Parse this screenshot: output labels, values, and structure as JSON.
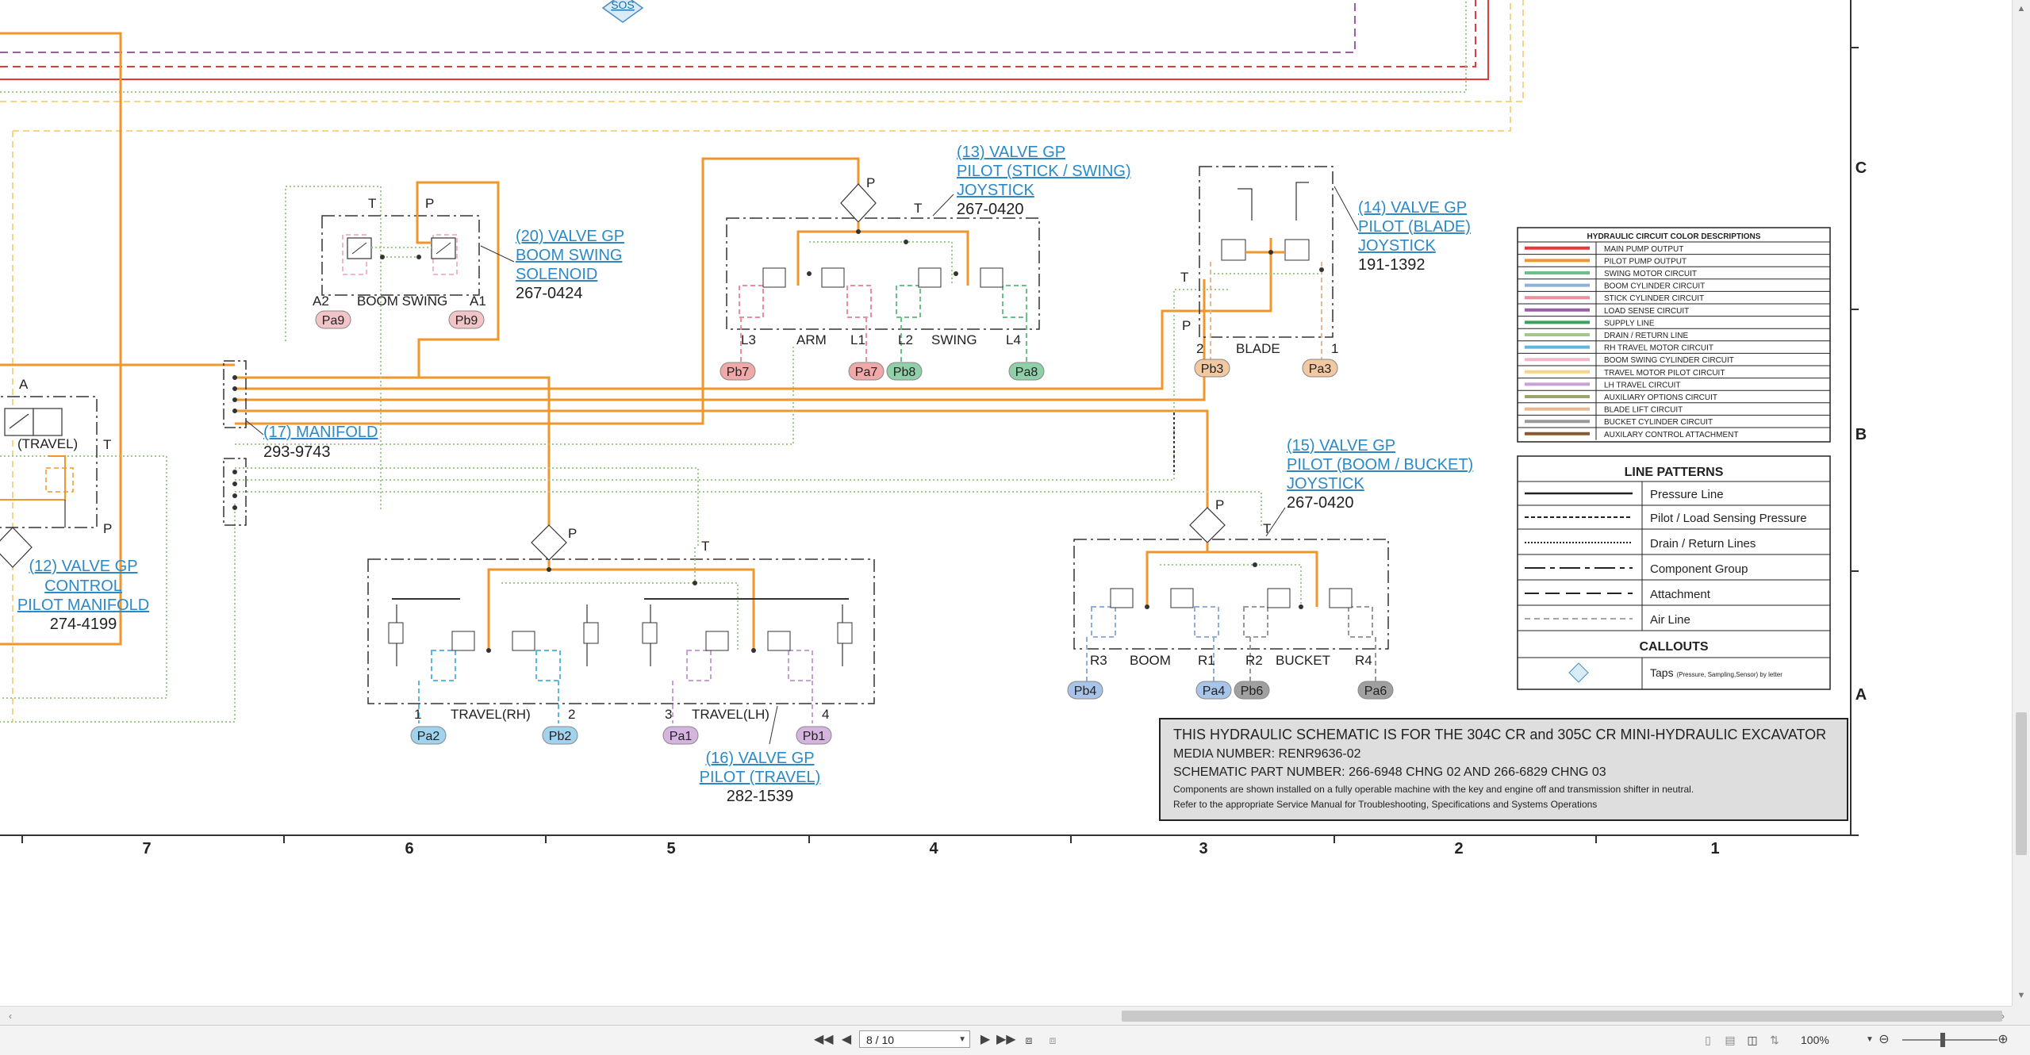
{
  "schematic": {
    "components": {
      "c12": {
        "ref": "(12)",
        "lines": [
          "VALVE GP",
          "CONTROL",
          "PILOT MANIFOLD"
        ],
        "part": "274-4199",
        "inner_label": "(TRAVEL)"
      },
      "c13": {
        "ref": "(13)",
        "lines": [
          "VALVE GP",
          "PILOT (STICK / SWING)",
          "JOYSTICK"
        ],
        "part": "267-0420"
      },
      "c14": {
        "ref": "(14)",
        "lines": [
          "VALVE GP",
          "PILOT (BLADE)",
          "JOYSTICK"
        ],
        "part": "191-1392"
      },
      "c15": {
        "ref": "(15)",
        "lines": [
          "VALVE GP",
          "PILOT (BOOM / BUCKET)",
          "JOYSTICK"
        ],
        "part": "267-0420"
      },
      "c16": {
        "ref": "(16)",
        "lines": [
          "VALVE GP",
          "PILOT (TRAVEL)"
        ],
        "part": "282-1539"
      },
      "c17": {
        "ref": "(17)",
        "lines": [
          "MANIFOLD"
        ],
        "part": "293-9743"
      },
      "c20": {
        "ref": "(20)",
        "lines": [
          "VALVE GP",
          "BOOM SWING",
          "SOLENOID"
        ],
        "part": "267-0424"
      }
    },
    "sos_label": "SOS",
    "labels": {
      "boom_swing": "BOOM SWING",
      "arm": "ARM",
      "swing": "SWING",
      "blade": "BLADE",
      "boom": "BOOM",
      "bucket": "BUCKET",
      "travel_rh": "TRAVEL(RH)",
      "travel_lh": "TRAVEL(LH)",
      "a1": "A1",
      "a2": "A2",
      "a": "A",
      "p": "P",
      "t": "T",
      "l1": "L1",
      "l2": "L2",
      "l3": "L3",
      "l4": "L4",
      "r1": "R1",
      "r2": "R2",
      "r3": "R3",
      "r4": "R4",
      "n1": "1",
      "n2": "2",
      "n3": "3",
      "n4": "4"
    },
    "taps": {
      "pa9": "Pa9",
      "pb9": "Pb9",
      "pb7": "Pb7",
      "pa7": "Pa7",
      "pb8": "Pb8",
      "pa8": "Pa8",
      "pb3": "Pb3",
      "pa3": "Pa3",
      "pa2": "Pa2",
      "pb2": "Pb2",
      "pa1": "Pa1",
      "pb1": "Pb1",
      "pb4": "Pb4",
      "pa4": "Pa4",
      "pb6": "Pb6",
      "pa6": "Pa6"
    },
    "tap_colors": {
      "pink": "#f2c4c8",
      "salmon": "#f0a8a8",
      "green": "#8fd0a8",
      "peach": "#f2c8a0",
      "blue": "#9fd3ee",
      "violet": "#d6b4e0",
      "steelblue": "#a8c4e8",
      "gray": "#a0a0a0"
    },
    "color_table": {
      "title": "HYDRAULIC CIRCUIT COLOR DESCRIPTIONS",
      "rows": [
        {
          "label": "MAIN PUMP OUTPUT",
          "color": "#e63a3a"
        },
        {
          "label": "PILOT PUMP OUTPUT",
          "color": "#f0962b"
        },
        {
          "label": "SWING MOTOR CIRCUIT",
          "color": "#6cc08a"
        },
        {
          "label": "BOOM CYLINDER CIRCUIT",
          "color": "#8fb0dc"
        },
        {
          "label": "STICK CYLINDER CIRCUIT",
          "color": "#ec8f9b"
        },
        {
          "label": "LOAD SENSE CIRCUIT",
          "color": "#9b5fa8"
        },
        {
          "label": "SUPPLY LINE",
          "color": "#3aa25a"
        },
        {
          "label": "DRAIN / RETURN LINE",
          "color": "#a3c98a"
        },
        {
          "label": "RH TRAVEL MOTOR CIRCUIT",
          "color": "#5cb8e0"
        },
        {
          "label": "BOOM SWING CYLINDER CIRCUIT",
          "color": "#f2b8c8"
        },
        {
          "label": "TRAVEL MOTOR PILOT CIRCUIT",
          "color": "#f5d58a"
        },
        {
          "label": "LH TRAVEL CIRCUIT",
          "color": "#c9a0d8"
        },
        {
          "label": "AUXILIARY OPTIONS CIRCUIT",
          "color": "#9aa56a"
        },
        {
          "label": "BLADE LIFT CIRCUIT",
          "color": "#e8b890"
        },
        {
          "label": "BUCKET CYLINDER CIRCUIT",
          "color": "#9a9a9a"
        },
        {
          "label": "AUXILARY CONTROL ATTACHMENT",
          "color": "#8a5a2a"
        }
      ]
    },
    "line_patterns": {
      "title": "LINE PATTERNS",
      "rows": [
        "Pressure Line",
        "Pilot / Load Sensing Pressure",
        "Drain / Return Lines",
        "Component Group",
        "Attachment",
        "Air Line"
      ],
      "callouts_title": "CALLOUTS",
      "taps_label": "Taps",
      "taps_note": "(Pressure, Sampling,Sensor) by letter"
    },
    "note": {
      "title": "THIS HYDRAULIC SCHEMATIC IS FOR THE 304C CR and 305C CR MINI-HYDRAULIC EXCAVATOR",
      "media": "MEDIA NUMBER: RENR9636-02",
      "part": "SCHEMATIC PART NUMBER: 266-6948 CHNG 02 AND 266-6829 CHNG 03",
      "line1": "Components are shown installed on a fully operable machine with the key and engine off and transmission shifter in neutral.",
      "line2": "Refer to the appropriate Service Manual for Troubleshooting, Specifications and Systems Operations"
    },
    "grid_columns": [
      "7",
      "6",
      "5",
      "4",
      "3",
      "2",
      "1"
    ],
    "grid_rows": [
      "C",
      "B",
      "A"
    ]
  },
  "viewer": {
    "page_indicator": "8 / 10",
    "zoom": "100%"
  }
}
